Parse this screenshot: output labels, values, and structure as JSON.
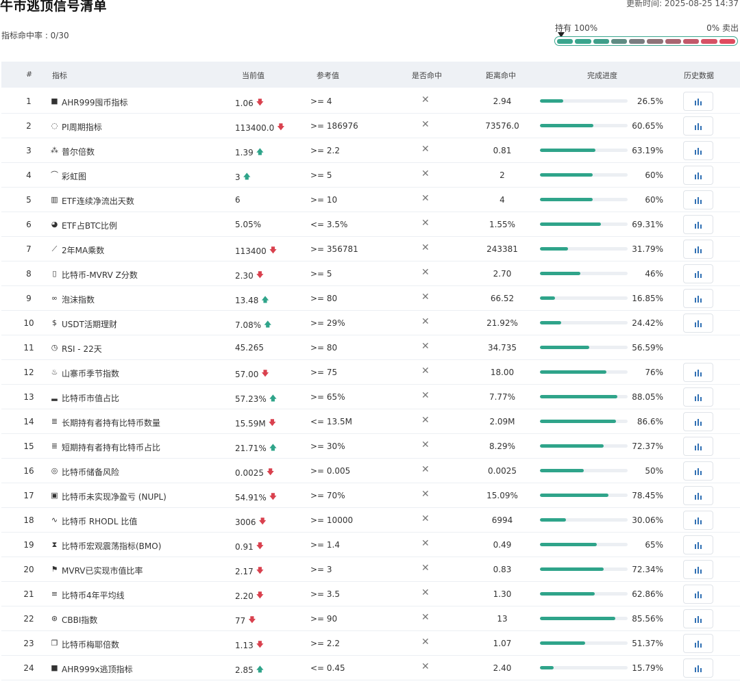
{
  "header": {
    "title": "牛市逃顶信号清单",
    "update_time": "更新时间: 2025-08-25 14:37",
    "hit_rate": "指标命中率 : 0/30"
  },
  "gauge": {
    "left_label": "持有 100%",
    "right_label": "0% 卖出",
    "colors": [
      "#3aa58d",
      "#3aa58d",
      "#3f9f8a",
      "#5f8c83",
      "#7a7d80",
      "#8e7378",
      "#a96671",
      "#c2596a",
      "#d65265",
      "#e04b5f"
    ]
  },
  "columns": {
    "idx": "#",
    "name": "指标",
    "current": "当前值",
    "reference": "参考值",
    "hit": "是否命中",
    "distance": "距离命中",
    "progress": "完成进度",
    "history": "历史数据"
  },
  "rows": [
    {
      "idx": "1",
      "icon": "square-badge-icon",
      "glyph": "■",
      "name": "AHR999囤币指标",
      "current": "1.06",
      "trend": "down",
      "ref": ">= 4",
      "hit": "✕",
      "distance": "2.94",
      "progress": 26.5,
      "pct": "26.5%",
      "history": true
    },
    {
      "idx": "2",
      "icon": "pi-cycle-icon",
      "glyph": "◌",
      "name": "PI周期指标",
      "current": "113400.0",
      "trend": "down",
      "ref": ">= 186976",
      "hit": "✕",
      "distance": "73576.0",
      "progress": 60.65,
      "pct": "60.65%",
      "history": true
    },
    {
      "idx": "3",
      "icon": "sparkle-icon",
      "glyph": "⁂",
      "name": "普尔倍数",
      "current": "1.39",
      "trend": "up",
      "ref": ">= 2.2",
      "hit": "✕",
      "distance": "0.81",
      "progress": 63.19,
      "pct": "63.19%",
      "history": true
    },
    {
      "idx": "4",
      "icon": "rainbow-icon",
      "glyph": "⌒",
      "name": "彩虹图",
      "current": "3",
      "trend": "up",
      "ref": ">= 5",
      "hit": "✕",
      "distance": "2",
      "progress": 60,
      "pct": "60%",
      "history": true
    },
    {
      "idx": "5",
      "icon": "bar-chart-icon",
      "glyph": "▥",
      "name": "ETF连续净流出天数",
      "current": "6",
      "trend": "",
      "ref": ">= 10",
      "hit": "✕",
      "distance": "4",
      "progress": 60,
      "pct": "60%",
      "history": true
    },
    {
      "idx": "6",
      "icon": "pie-chart-icon",
      "glyph": "◕",
      "name": "ETF占BTC比例",
      "current": "5.05%",
      "trend": "",
      "ref": "<= 3.5%",
      "hit": "✕",
      "distance": "1.55%",
      "progress": 69.31,
      "pct": "69.31%",
      "history": true
    },
    {
      "idx": "7",
      "icon": "line-chart-icon",
      "glyph": "⟋",
      "name": "2年MA乘数",
      "current": "113400",
      "trend": "down",
      "ref": ">= 356781",
      "hit": "✕",
      "distance": "243381",
      "progress": 31.79,
      "pct": "31.79%",
      "history": true
    },
    {
      "idx": "8",
      "icon": "clipboard-icon",
      "glyph": "▯",
      "name": "比特币-MVRV Z分数",
      "current": "2.30",
      "trend": "down",
      "ref": ">= 5",
      "hit": "✕",
      "distance": "2.70",
      "progress": 46,
      "pct": "46%",
      "history": true
    },
    {
      "idx": "9",
      "icon": "bubble-icon",
      "glyph": "∞",
      "name": "泡沫指数",
      "current": "13.48",
      "trend": "up",
      "ref": ">= 80",
      "hit": "✕",
      "distance": "66.52",
      "progress": 16.85,
      "pct": "16.85%",
      "history": true
    },
    {
      "idx": "10",
      "icon": "dollar-icon",
      "glyph": "$",
      "name": "USDT活期理财",
      "current": "7.08%",
      "trend": "up",
      "ref": ">= 29%",
      "hit": "✕",
      "distance": "21.92%",
      "progress": 24.42,
      "pct": "24.42%",
      "history": true
    },
    {
      "idx": "11",
      "icon": "clock-icon",
      "glyph": "◷",
      "name": "RSI - 22天",
      "current": "45.265",
      "trend": "",
      "ref": ">= 80",
      "hit": "✕",
      "distance": "34.735",
      "progress": 56.59,
      "pct": "56.59%",
      "history": false
    },
    {
      "idx": "12",
      "icon": "flame-icon",
      "glyph": "♨",
      "name": "山寨币季节指数",
      "current": "57.00",
      "trend": "down",
      "ref": ">= 75",
      "hit": "✕",
      "distance": "18.00",
      "progress": 76,
      "pct": "76%",
      "history": true
    },
    {
      "idx": "13",
      "icon": "signal-bars-icon",
      "glyph": "▂",
      "name": "比特币市值占比",
      "current": "57.23%",
      "trend": "up",
      "ref": ">= 65%",
      "hit": "✕",
      "distance": "7.77%",
      "progress": 88.05,
      "pct": "88.05%",
      "history": true
    },
    {
      "idx": "14",
      "icon": "database-icon",
      "glyph": "≣",
      "name": "长期持有者持有比特币数量",
      "current": "15.59M",
      "trend": "down",
      "ref": "<= 13.5M",
      "hit": "✕",
      "distance": "2.09M",
      "progress": 86.6,
      "pct": "86.6%",
      "history": true
    },
    {
      "idx": "15",
      "icon": "database-icon",
      "glyph": "≣",
      "name": "短期持有者持有比特币占比",
      "current": "21.71%",
      "trend": "up",
      "ref": ">= 30%",
      "hit": "✕",
      "distance": "8.29%",
      "progress": 72.37,
      "pct": "72.37%",
      "history": true
    },
    {
      "idx": "16",
      "icon": "coins-icon",
      "glyph": "◎",
      "name": "比特币储备风险",
      "current": "0.0025",
      "trend": "down",
      "ref": ">= 0.005",
      "hit": "✕",
      "distance": "0.0025",
      "progress": 50,
      "pct": "50%",
      "history": true
    },
    {
      "idx": "17",
      "icon": "wallet-icon",
      "glyph": "▣",
      "name": "比特币未实现净盈亏 (NUPL)",
      "current": "54.91%",
      "trend": "down",
      "ref": ">= 70%",
      "hit": "✕",
      "distance": "15.09%",
      "progress": 78.45,
      "pct": "78.45%",
      "history": true
    },
    {
      "idx": "18",
      "icon": "pulse-icon",
      "glyph": "∿",
      "name": "比特币 RHODL 比值",
      "current": "3006",
      "trend": "down",
      "ref": ">= 10000",
      "hit": "✕",
      "distance": "6994",
      "progress": 30.06,
      "pct": "30.06%",
      "history": true
    },
    {
      "idx": "19",
      "icon": "hourglass-icon",
      "glyph": "⧗",
      "name": "比特币宏观震荡指标(BMO)",
      "current": "0.91",
      "trend": "down",
      "ref": ">= 1.4",
      "hit": "✕",
      "distance": "0.49",
      "progress": 65,
      "pct": "65%",
      "history": true
    },
    {
      "idx": "20",
      "icon": "flag-icon",
      "glyph": "⚑",
      "name": "MVRV已实现市值比率",
      "current": "2.17",
      "trend": "down",
      "ref": ">= 3",
      "hit": "✕",
      "distance": "0.83",
      "progress": 72.34,
      "pct": "72.34%",
      "history": true
    },
    {
      "idx": "21",
      "icon": "list-icon",
      "glyph": "≡",
      "name": "比特币4年平均线",
      "current": "2.20",
      "trend": "down",
      "ref": ">= 3.5",
      "hit": "✕",
      "distance": "1.30",
      "progress": 62.86,
      "pct": "62.86%",
      "history": true
    },
    {
      "idx": "22",
      "icon": "coin-icon",
      "glyph": "⊛",
      "name": "CBBI指数",
      "current": "77",
      "trend": "down",
      "ref": ">= 90",
      "hit": "✕",
      "distance": "13",
      "progress": 85.56,
      "pct": "85.56%",
      "history": true
    },
    {
      "idx": "23",
      "icon": "copy-icon",
      "glyph": "❐",
      "name": "比特币梅耶倍数",
      "current": "1.13",
      "trend": "down",
      "ref": ">= 2.2",
      "hit": "✕",
      "distance": "1.07",
      "progress": 51.37,
      "pct": "51.37%",
      "history": true
    },
    {
      "idx": "24",
      "icon": "square-badge-icon",
      "glyph": "■",
      "name": "AHR999x逃顶指标",
      "current": "2.85",
      "trend": "up",
      "ref": "<= 0.45",
      "hit": "✕",
      "distance": "2.40",
      "progress": 15.79,
      "pct": "15.79%",
      "history": true
    }
  ]
}
